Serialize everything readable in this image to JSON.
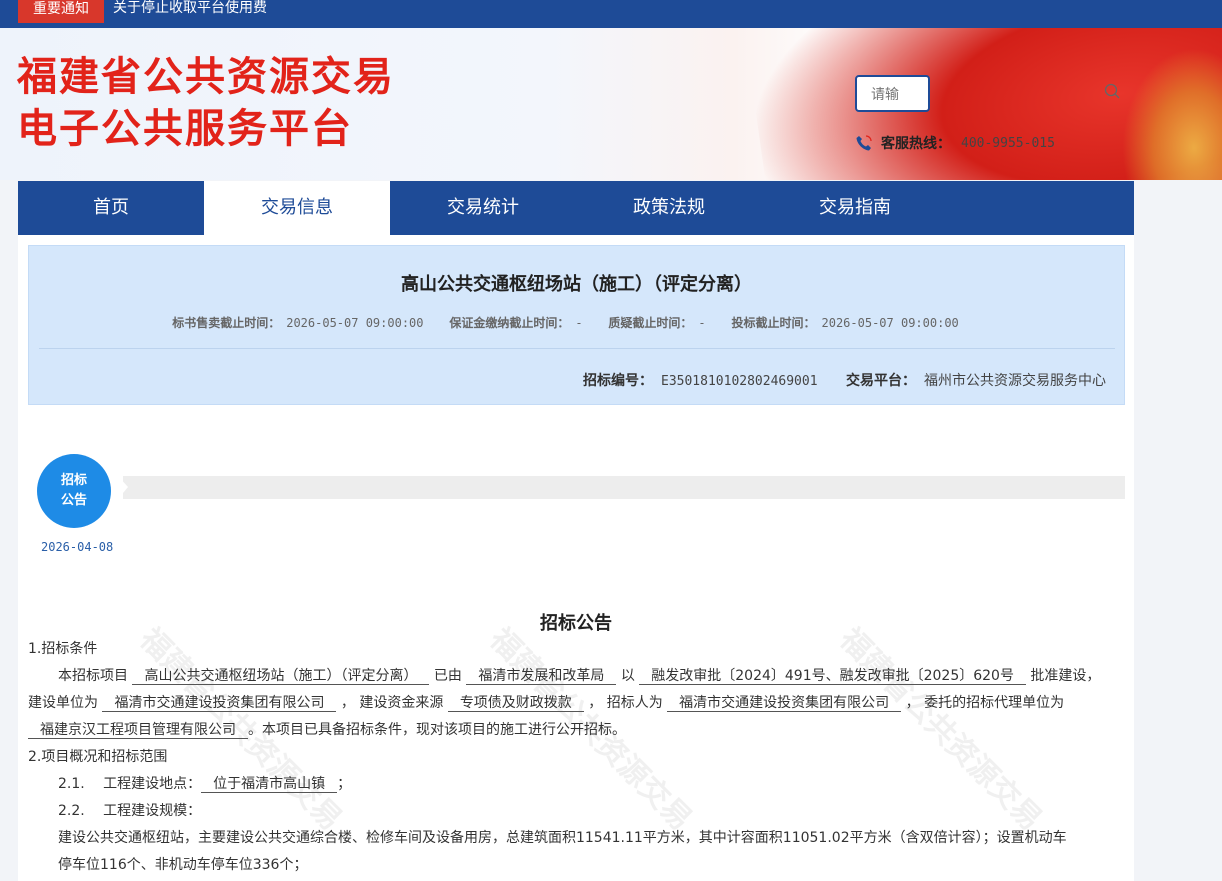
{
  "notice": {
    "tag": "重要通知",
    "text": "关于停止收取平台使用费"
  },
  "header": {
    "logo_line1": "福建省公共资源交易",
    "logo_line2": "电子公共服务平台",
    "search_placeholder": "请输",
    "hotline_label": "客服热线：",
    "hotline_value": "400-9955-015"
  },
  "nav": [
    {
      "label": "首页"
    },
    {
      "label": "交易信息"
    },
    {
      "label": "交易统计"
    },
    {
      "label": "政策法规"
    },
    {
      "label": "交易指南"
    }
  ],
  "project": {
    "title": "高山公共交通枢纽场站（施工）（评定分离）",
    "times": [
      {
        "label": "标书售卖截止时间：",
        "value": "2026-05-07 09:00:00"
      },
      {
        "label": "保证金缴纳截止时间：",
        "value": "-"
      },
      {
        "label": "质疑截止时间：",
        "value": "-"
      },
      {
        "label": "投标截止时间：",
        "value": "2026-05-07 09:00:00"
      }
    ],
    "code_label": "招标编号：",
    "code_value": "E3501810102802469001",
    "platform_label": "交易平台：",
    "platform_value": "福州市公共资源交易服务中心"
  },
  "stage": {
    "line1": "招标",
    "line2": "公告",
    "date": "2026-04-08"
  },
  "document": {
    "title": "招标公告",
    "s1_heading": "1.招标条件",
    "s1_a": "本招标项目",
    "s1_project": "高山公共交通枢纽场站（施工）（评定分离）",
    "s1_b": "已由",
    "s1_approver": "福清市发展和改革局",
    "s1_c": "以",
    "s1_approval": "融发改审批〔2024〕491号、融发改审批〔2025〕620号",
    "s1_d": "批准建设，",
    "s1_e": "建设单位为",
    "s1_owner": "福清市交通建设投资集团有限公司",
    "s1_f": "，  建设资金来源",
    "s1_fund": "专项债及财政拨款",
    "s1_g": "，  招标人为",
    "s1_tenderer": "福清市交通建设投资集团有限公司",
    "s1_h": "，  委托的招标代理单位为",
    "s1_agent": "福建京汉工程项目管理有限公司",
    "s1_i": "。本项目已具备招标条件，现对该项目的施工进行公开招标。",
    "s2_heading": "2.项目概况和招标范围",
    "s21_label": "2.1.　 工程建设地点：",
    "s21_value": "位于福清市高山镇",
    "s21_end": "；",
    "s22_label": "2.2.　 工程建设规模：",
    "s22_text1": "建设公共交通枢纽站，主要建设公共交通综合楼、检修车间及设备用房，总建筑面积11541.11平方米，其中计容面积11051.02平方米（含双倍计容）；设置机动车",
    "s22_text2": "停车位116个、非机动车停车位336个；"
  },
  "colors": {
    "primary": "#1e4b97",
    "accent_red": "#e2231a",
    "stage_blue": "#1e8be6",
    "info_bg": "#d5e7fb"
  },
  "icons": [
    "search-icon",
    "phone-icon"
  ]
}
